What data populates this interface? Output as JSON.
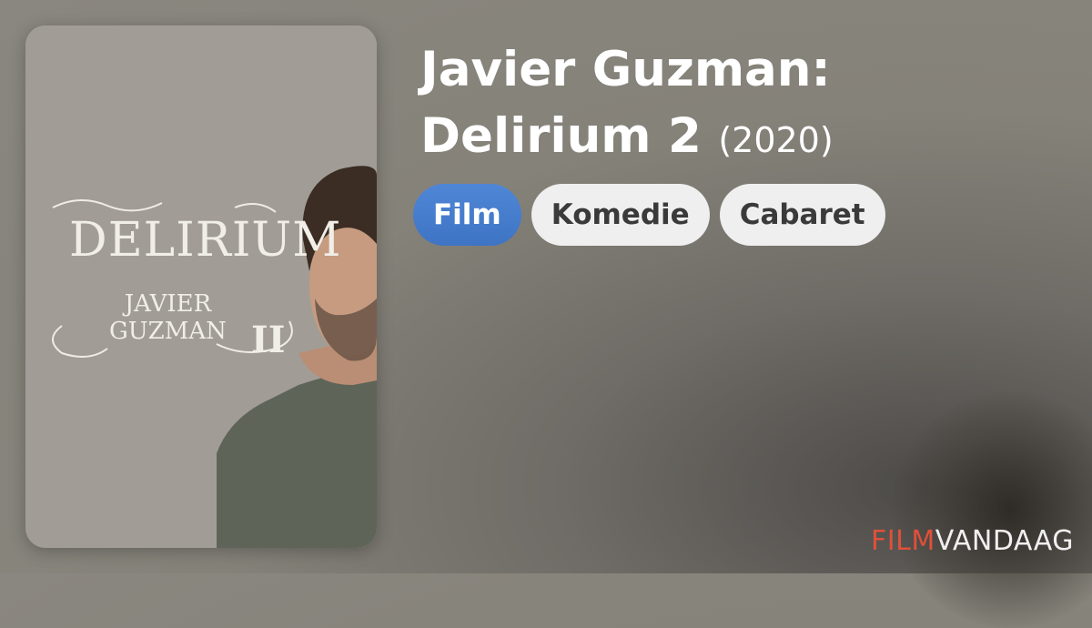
{
  "movie": {
    "title": "Javier Guzman: Delirium 2",
    "year": "(2020)",
    "poster": {
      "title": "DELIRIUM",
      "subtitle_line1": "JAVIER",
      "subtitle_line2": "GUZMAN",
      "numeral": "II"
    }
  },
  "tags": [
    "Film",
    "Komedie",
    "Cabaret"
  ],
  "brand": {
    "part1": "FILM",
    "part2": "VANDAAG"
  },
  "colors": {
    "primary_tag": "#3f74c4",
    "brand_accent": "#e0503a"
  }
}
